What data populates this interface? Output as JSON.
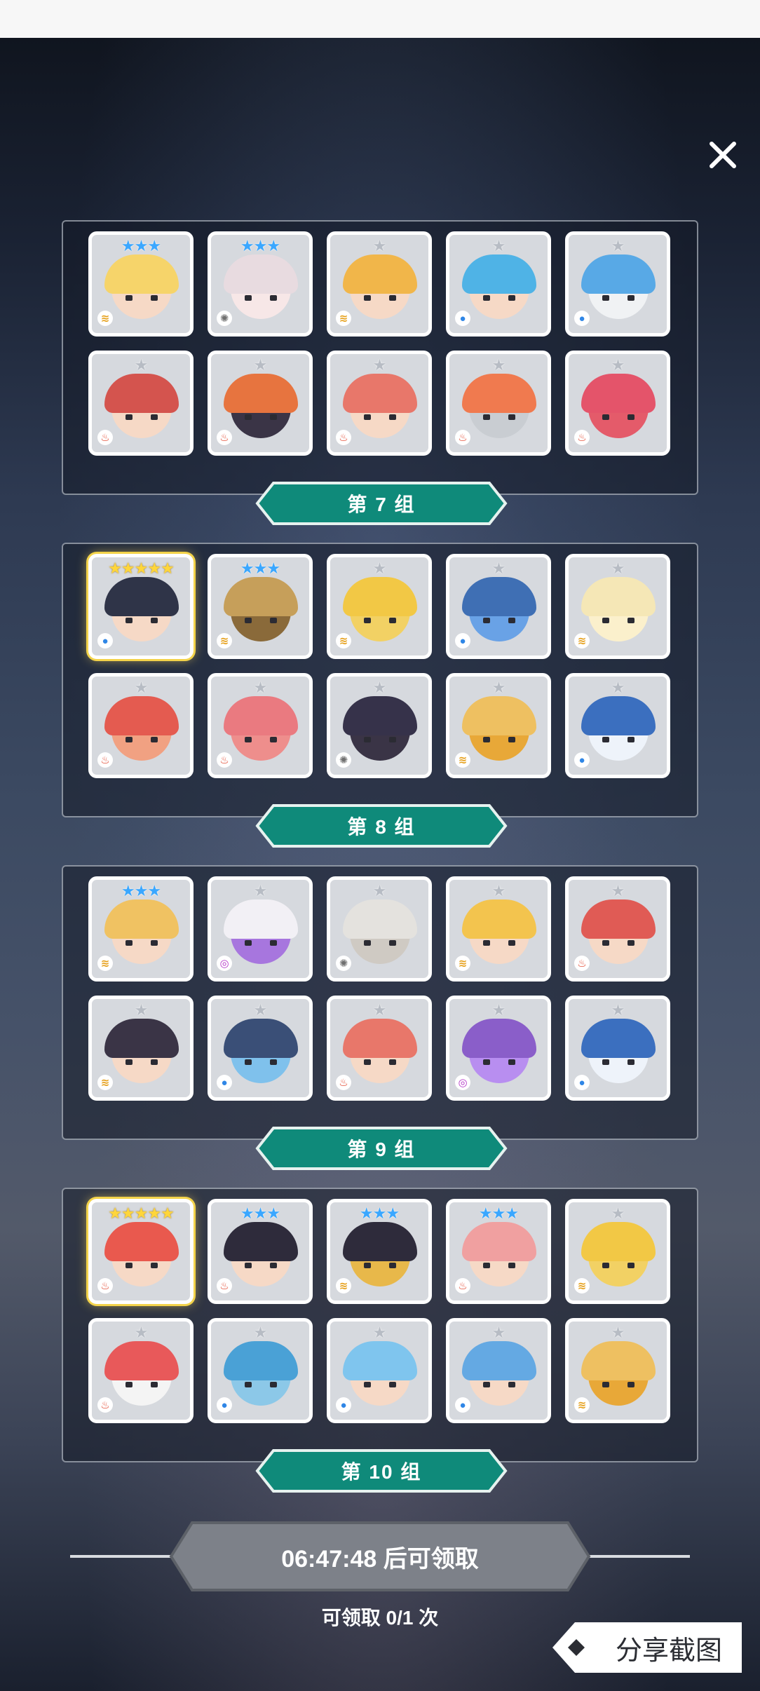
{
  "groups": [
    {
      "label": "第 7 组",
      "cards": [
        {
          "stars": "★★★",
          "star_color": "blue",
          "element": "wind",
          "hair": "#f6d46a",
          "face": "#f6d9c6"
        },
        {
          "stars": "★★★",
          "star_color": "blue",
          "element": "light",
          "hair": "#e8dbe0",
          "face": "#f7e7e7"
        },
        {
          "stars": "★",
          "star_color": "grey",
          "element": "wind",
          "hair": "#f1b64a",
          "face": "#f6d9c6"
        },
        {
          "stars": "★",
          "star_color": "grey",
          "element": "water",
          "hair": "#4fb3e6",
          "face": "#f6d9c6"
        },
        {
          "stars": "★",
          "star_color": "grey",
          "element": "water",
          "hair": "#58a9e6",
          "face": "#f0f2f4"
        },
        {
          "stars": "★",
          "star_color": "grey",
          "element": "fire",
          "hair": "#d4544e",
          "face": "#f6d9c6"
        },
        {
          "stars": "★",
          "star_color": "grey",
          "element": "fire",
          "hair": "#e7743f",
          "face": "#3a3446"
        },
        {
          "stars": "★",
          "star_color": "grey",
          "element": "fire",
          "hair": "#e8776a",
          "face": "#f6d9c6"
        },
        {
          "stars": "★",
          "star_color": "grey",
          "element": "fire",
          "hair": "#f07a4f",
          "face": "#c9cdd2"
        },
        {
          "stars": "★",
          "star_color": "grey",
          "element": "fire",
          "hair": "#e4546a",
          "face": "#e45b6a"
        }
      ]
    },
    {
      "label": "第 8 组",
      "cards": [
        {
          "stars": "★★★★★",
          "star_color": "gold",
          "element": "water",
          "hair": "#2f3448",
          "face": "#f6d9c6",
          "gold": true
        },
        {
          "stars": "★★★",
          "star_color": "blue",
          "element": "wind",
          "hair": "#c69f5a",
          "face": "#8a6a3a"
        },
        {
          "stars": "★",
          "star_color": "grey",
          "element": "wind",
          "hair": "#f2c845",
          "face": "#f2d164"
        },
        {
          "stars": "★",
          "star_color": "grey",
          "element": "water",
          "hair": "#3f6fb4",
          "face": "#69a2e6"
        },
        {
          "stars": "★",
          "star_color": "grey",
          "element": "wind",
          "hair": "#f5e7b6",
          "face": "#fbf0cc"
        },
        {
          "stars": "★",
          "star_color": "grey",
          "element": "fire",
          "hair": "#e45b50",
          "face": "#f1a182"
        },
        {
          "stars": "★",
          "star_color": "grey",
          "element": "fire",
          "hair": "#ea7a80",
          "face": "#ee8e8c"
        },
        {
          "stars": "★",
          "star_color": "grey",
          "element": "light",
          "hair": "#36324a",
          "face": "#3a3446"
        },
        {
          "stars": "★",
          "star_color": "grey",
          "element": "wind",
          "hair": "#eec061",
          "face": "#e8a838"
        },
        {
          "stars": "★",
          "star_color": "grey",
          "element": "water",
          "hair": "#3b6fbf",
          "face": "#eef3fa"
        }
      ]
    },
    {
      "label": "第 9 组",
      "cards": [
        {
          "stars": "★★★",
          "star_color": "blue",
          "element": "wind",
          "hair": "#f0c262",
          "face": "#f6d9c6"
        },
        {
          "stars": "★",
          "star_color": "grey",
          "element": "dark",
          "hair": "#f2f0f5",
          "face": "#a776de"
        },
        {
          "stars": "★",
          "star_color": "grey",
          "element": "light",
          "hair": "#e4e2de",
          "face": "#cfcac3"
        },
        {
          "stars": "★",
          "star_color": "grey",
          "element": "wind",
          "hair": "#f3c44e",
          "face": "#f6d9c6"
        },
        {
          "stars": "★",
          "star_color": "grey",
          "element": "fire",
          "hair": "#e05b55",
          "face": "#f6d9c6"
        },
        {
          "stars": "★",
          "star_color": "grey",
          "element": "wind",
          "hair": "#3a3446",
          "face": "#f6d9c6"
        },
        {
          "stars": "★",
          "star_color": "grey",
          "element": "water",
          "hair": "#3a4f77",
          "face": "#7fc1ec"
        },
        {
          "stars": "★",
          "star_color": "grey",
          "element": "fire",
          "hair": "#e8776a",
          "face": "#f6d9c6"
        },
        {
          "stars": "★",
          "star_color": "grey",
          "element": "dark",
          "hair": "#8a5ec9",
          "face": "#b88ef0"
        },
        {
          "stars": "★",
          "star_color": "grey",
          "element": "water",
          "hair": "#3b6fbf",
          "face": "#eef3fa"
        }
      ]
    },
    {
      "label": "第 10 组",
      "cards": [
        {
          "stars": "★★★★★",
          "star_color": "gold",
          "element": "fire",
          "hair": "#e9594e",
          "face": "#f6d9c6",
          "gold": true
        },
        {
          "stars": "★★★",
          "star_color": "blue",
          "element": "fire",
          "hair": "#2e2b3b",
          "face": "#f6d9c6"
        },
        {
          "stars": "★★★",
          "star_color": "blue",
          "element": "wind",
          "hair": "#2e2b3b",
          "face": "#e8b84a"
        },
        {
          "stars": "★★★",
          "star_color": "blue",
          "element": "fire",
          "hair": "#f0a0a0",
          "face": "#f6d9c6"
        },
        {
          "stars": "★",
          "star_color": "grey",
          "element": "wind",
          "hair": "#f2c845",
          "face": "#f2d164"
        },
        {
          "stars": "★",
          "star_color": "grey",
          "element": "fire",
          "hair": "#e8595a",
          "face": "#f4f4f4"
        },
        {
          "stars": "★",
          "star_color": "grey",
          "element": "water",
          "hair": "#4aa1d6",
          "face": "#8cc8e8"
        },
        {
          "stars": "★",
          "star_color": "grey",
          "element": "water",
          "hair": "#7fc5ee",
          "face": "#f6d9c6"
        },
        {
          "stars": "★",
          "star_color": "grey",
          "element": "water",
          "hair": "#64a9e3",
          "face": "#f6d9c6"
        },
        {
          "stars": "★",
          "star_color": "grey",
          "element": "wind",
          "hair": "#eec061",
          "face": "#e8a838"
        }
      ]
    }
  ],
  "element_glyphs": {
    "fire": "♨",
    "water": "●",
    "wind": "≋",
    "light": "✺",
    "dark": "◎"
  },
  "claim": {
    "button_label": "06:47:48 后可领取",
    "count_text": "可领取 0/1 次"
  },
  "share": {
    "label": "分享截图"
  },
  "colors": {
    "label_teal": "#0f8a7a",
    "label_border": "#e6f2ef",
    "claim_grey": "#7d8189"
  }
}
